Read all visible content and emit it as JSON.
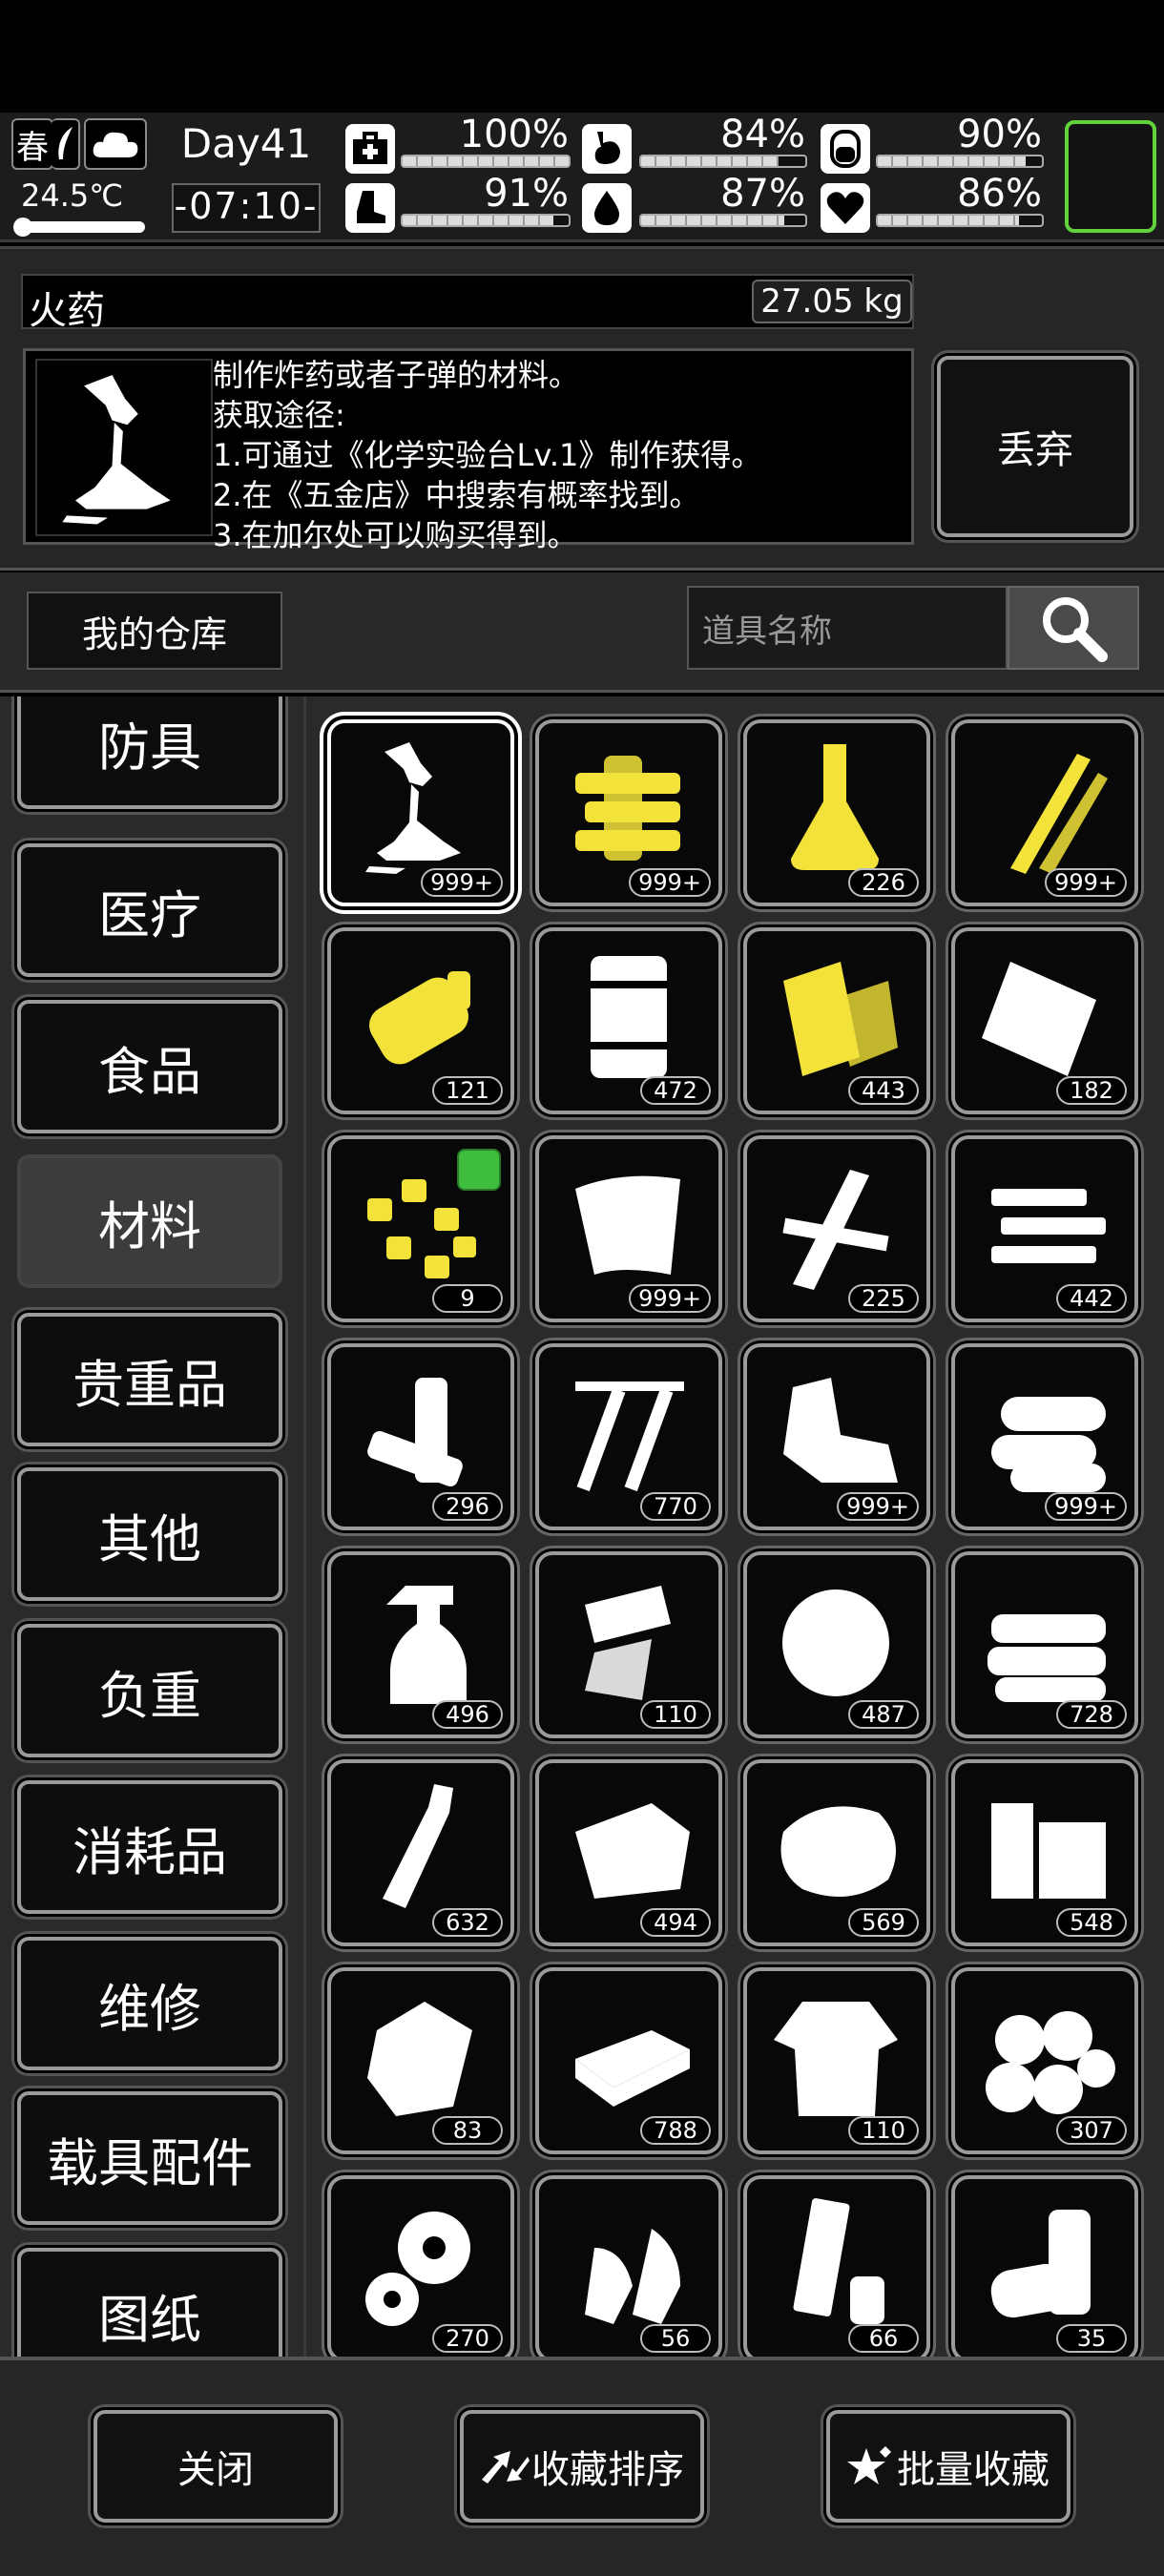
{
  "status": {
    "season": "春",
    "temperature": "24.5℃",
    "day": "Day41",
    "time": "-07:10-",
    "stats": [
      {
        "icon": "medkit-icon",
        "value": "100%",
        "fraction": 1.0
      },
      {
        "icon": "stomach-icon",
        "value": "84%",
        "fraction": 0.84
      },
      {
        "icon": "bladder-icon",
        "value": "90%",
        "fraction": 0.9
      },
      {
        "icon": "boot-icon",
        "value": "91%",
        "fraction": 0.91
      },
      {
        "icon": "water-drop-icon",
        "value": "87%",
        "fraction": 0.87
      },
      {
        "icon": "heart-icon",
        "value": "86%",
        "fraction": 0.86
      }
    ],
    "colors": {
      "equip_slot_border": "#62d23a"
    }
  },
  "detail": {
    "name": "火药",
    "weight": "27.05 kg",
    "description": [
      "制作炸药或者子弹的材料。",
      "获取途径:",
      "1.可通过《化学实验台Lv.1》制作获得。",
      "2.在《五金店》中搜索有概率找到。",
      "3.在加尔处可以购买得到。"
    ],
    "discard_label": "丢弃"
  },
  "search": {
    "storage_label": "我的仓库",
    "placeholder": "道具名称"
  },
  "categories": [
    {
      "label": "防具"
    },
    {
      "label": "医疗"
    },
    {
      "label": "食品"
    },
    {
      "label": "材料",
      "active": true
    },
    {
      "label": "贵重品"
    },
    {
      "label": "其他"
    },
    {
      "label": "负重"
    },
    {
      "label": "消耗品"
    },
    {
      "label": "维修"
    },
    {
      "label": "载具配件"
    },
    {
      "label": "图纸"
    }
  ],
  "items": [
    {
      "icon": "gunpowder-icon",
      "count": "999+",
      "selected": true,
      "color": "#ffffff"
    },
    {
      "icon": "cable-bundle-icon",
      "count": "999+",
      "color": "#f2e23a"
    },
    {
      "icon": "flask-icon",
      "count": "226",
      "color": "#f2e23a"
    },
    {
      "icon": "wire-icon",
      "count": "999+",
      "color": "#f2e23a"
    },
    {
      "icon": "battery-cell-icon",
      "count": "121",
      "color": "#f2e23a"
    },
    {
      "icon": "fuel-barrel-icon",
      "count": "472",
      "color": "#ffffff"
    },
    {
      "icon": "planks-icon",
      "count": "443",
      "color": "#f2e23a"
    },
    {
      "icon": "bag-icon",
      "count": "182",
      "color": "#ffffff"
    },
    {
      "icon": "scraps-icon",
      "count": "9",
      "color": "#f2e23a",
      "new": true
    },
    {
      "icon": "cloth-sheet-icon",
      "count": "999+",
      "color": "#ffffff"
    },
    {
      "icon": "wood-board-icon",
      "count": "225",
      "color": "#ffffff"
    },
    {
      "icon": "metal-strips-icon",
      "count": "442",
      "color": "#ffffff"
    },
    {
      "icon": "batteries-icon",
      "count": "296",
      "color": "#ffffff"
    },
    {
      "icon": "screws-icon",
      "count": "770",
      "color": "#ffffff"
    },
    {
      "icon": "scrap-metal-icon",
      "count": "999+",
      "color": "#ffffff"
    },
    {
      "icon": "logs-icon",
      "count": "999+",
      "color": "#ffffff"
    },
    {
      "icon": "spray-bottle-icon",
      "count": "496",
      "color": "#ffffff"
    },
    {
      "icon": "glass-shards-icon",
      "count": "110",
      "color": "#ffffff"
    },
    {
      "icon": "fiber-ball-icon",
      "count": "487",
      "color": "#ffffff"
    },
    {
      "icon": "towels-icon",
      "count": "728",
      "color": "#ffffff"
    },
    {
      "icon": "bottle-icon",
      "count": "632",
      "color": "#ffffff"
    },
    {
      "icon": "leather-icon",
      "count": "494",
      "color": "#ffffff"
    },
    {
      "icon": "meat-icon",
      "count": "569",
      "color": "#ffffff"
    },
    {
      "icon": "wood-blocks-icon",
      "count": "548",
      "color": "#ffffff"
    },
    {
      "icon": "rock-icon",
      "count": "83",
      "color": "#ffffff"
    },
    {
      "icon": "brick-icon",
      "count": "788",
      "color": "#ffffff"
    },
    {
      "icon": "rag-shirt-icon",
      "count": "110",
      "color": "#ffffff"
    },
    {
      "icon": "cotton-icon",
      "count": "307",
      "color": "#ffffff"
    },
    {
      "icon": "gears-icon",
      "count": "270",
      "color": "#ffffff"
    },
    {
      "icon": "bullets-icon",
      "count": "56",
      "color": "#ffffff"
    },
    {
      "icon": "pipe-icon",
      "count": "66",
      "color": "#ffffff"
    },
    {
      "icon": "cans-icon",
      "count": "35",
      "color": "#ffffff"
    }
  ],
  "bottom": {
    "close_label": "关闭",
    "sort_label": "收藏排序",
    "batch_label": "批量收藏"
  }
}
